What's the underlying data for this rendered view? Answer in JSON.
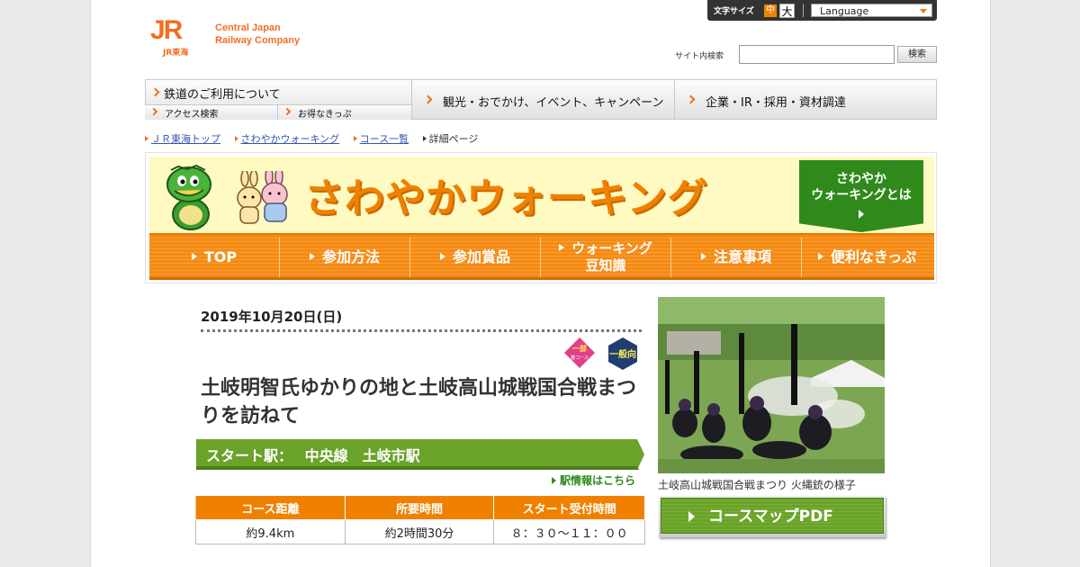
{
  "header": {
    "logo_mark": "JR",
    "logo_sub": "JR東海",
    "logo_line1": "Central Japan",
    "logo_line2": "Railway Company",
    "font_size_label": "文字サイズ",
    "font_size_mid": "中",
    "font_size_large": "大",
    "language_label": "Language",
    "search_label": "サイト内検索",
    "search_value": "",
    "search_button": "検索"
  },
  "global_nav": {
    "rail": "鉄道のご利用について",
    "rail_sub": [
      "アクセス検索",
      "お得なきっぷ"
    ],
    "tour": "観光・おでかけ、イベント、キャンペーン",
    "corp": "企業・IR・採用・資材調達"
  },
  "breadcrumb": [
    "ＪＲ東海トップ",
    "さわやかウォーキング",
    "コース一覧",
    "詳細ページ"
  ],
  "banner": {
    "title": "さわやかウォーキング",
    "about_line1": "さわやか",
    "about_line2": "ウォーキングとは",
    "nav": [
      "TOP",
      "参加方法",
      "参加賞品",
      "ウォーキング",
      "豆知識",
      "注意事項",
      "便利なきっぷ"
    ]
  },
  "course": {
    "date": "2019年10月20日(日)",
    "badge_part_line1": "一部",
    "badge_part_line2": "難コース",
    "badge_general": "一般向",
    "title": "土岐明智氏ゆかりの地と土岐高山城戦国合戦まつりを訪ねて",
    "start_label": "スタート駅：",
    "start_station": "中央線　土岐市駅",
    "station_info_link": "駅情報はこちら",
    "table_headers": [
      "コース距離",
      "所要時間",
      "スタート受付時間"
    ],
    "table_values": [
      "約9.4km",
      "約2時間30分",
      "８：３０～１１：００"
    ]
  },
  "photo": {
    "caption": "土岐高山城戦国合戦まつり 火縄銃の様子"
  },
  "pdf_button": "コースマップPDF",
  "colors": {
    "brand_orange": "#f26e22",
    "nav_orange": "#f08100",
    "green": "#2f8a1b",
    "banner_yellow": "#fff9c2"
  }
}
